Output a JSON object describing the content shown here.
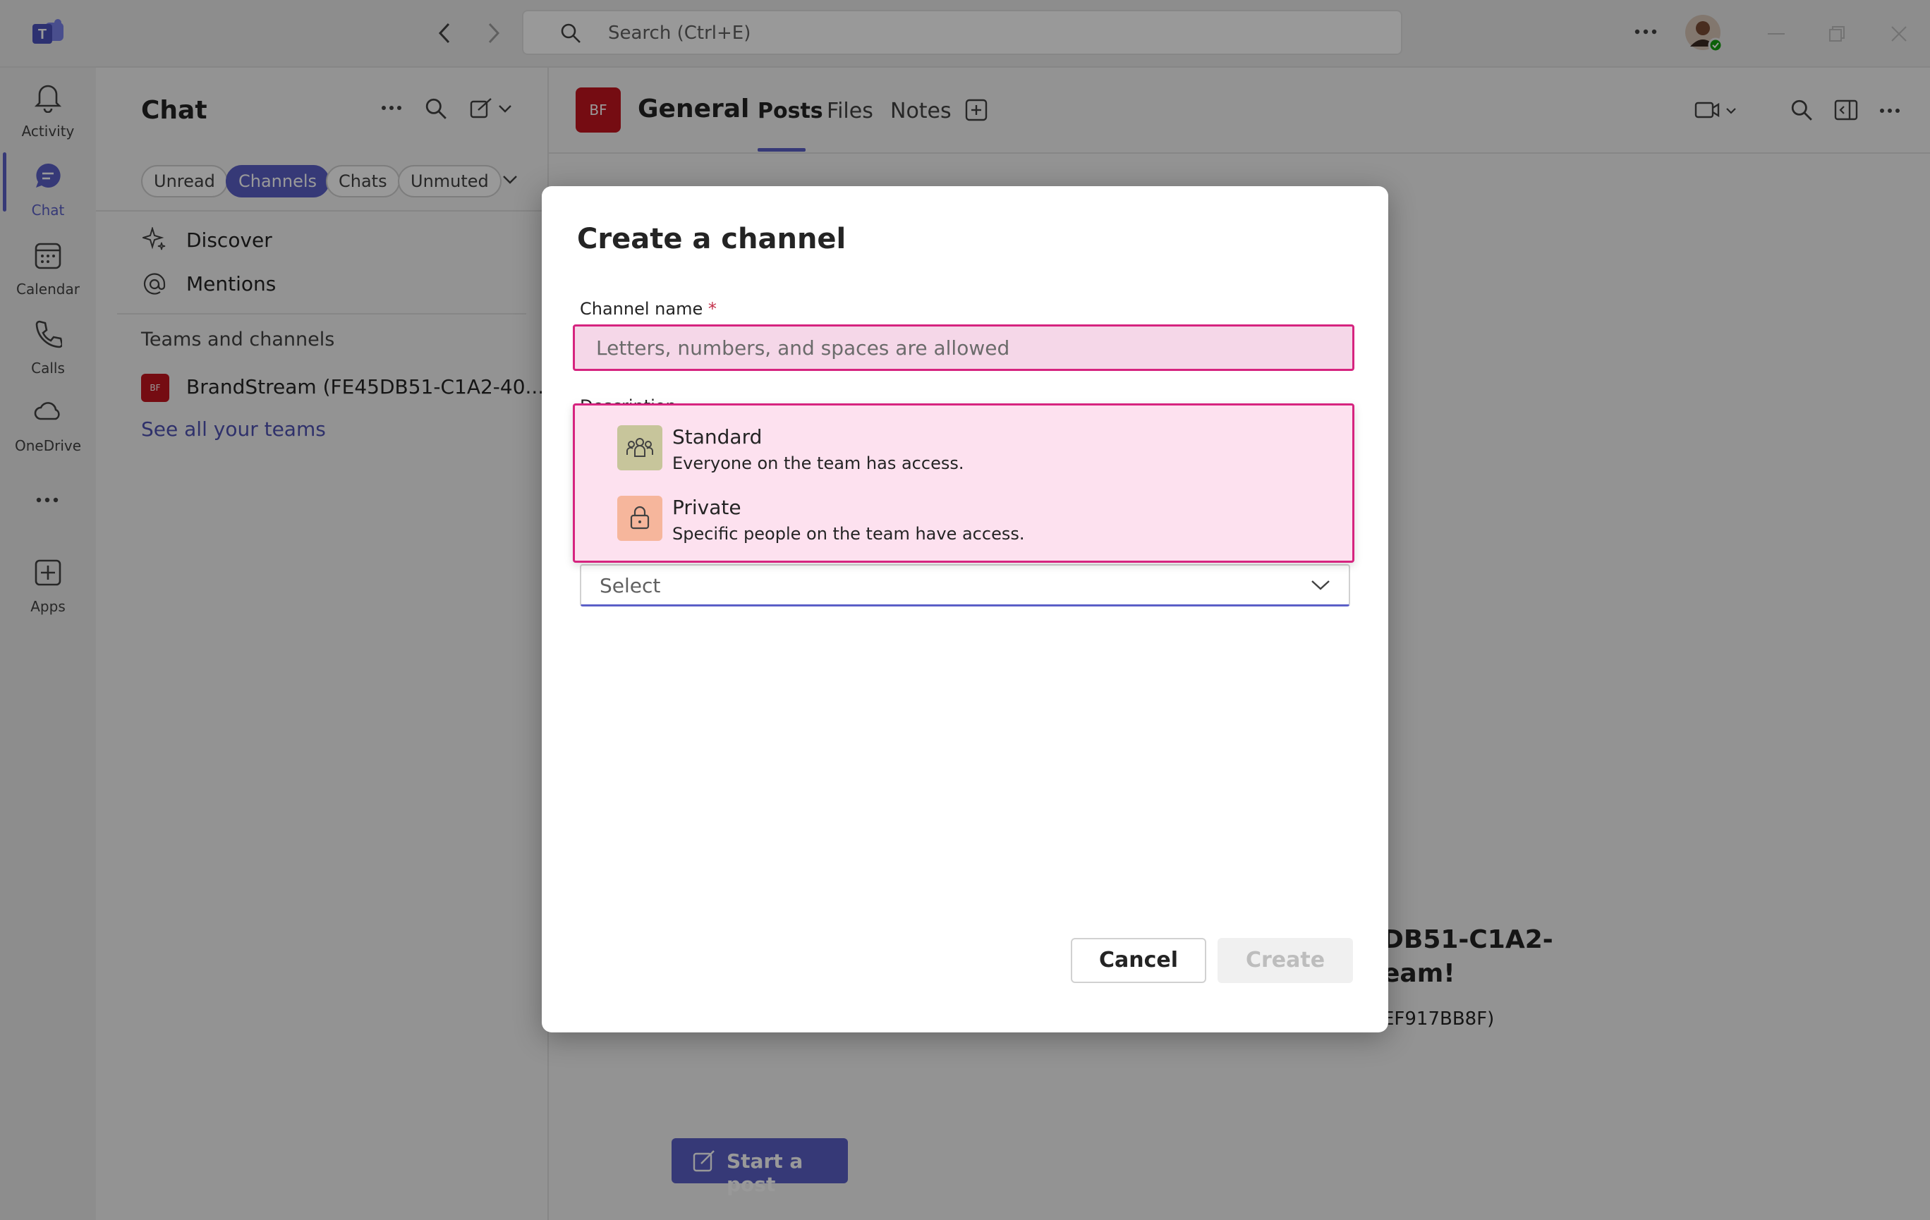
{
  "topbar": {
    "search_placeholder": "Search (Ctrl+E)"
  },
  "rail": {
    "items": [
      {
        "label": "Activity",
        "icon": "bell-icon"
      },
      {
        "label": "Chat",
        "icon": "chat-icon"
      },
      {
        "label": "Calendar",
        "icon": "calendar-icon"
      },
      {
        "label": "Calls",
        "icon": "phone-icon"
      },
      {
        "label": "OneDrive",
        "icon": "cloud-icon"
      },
      {
        "label": "Apps",
        "icon": "add-apps-icon"
      }
    ]
  },
  "panel": {
    "title": "Chat",
    "filters": [
      "Unread",
      "Channels",
      "Chats",
      "Unmuted"
    ],
    "active_filter": "Channels",
    "discover": "Discover",
    "mentions": "Mentions",
    "section_heading": "Teams and channels",
    "team_name": "BrandStream (FE45DB51-C1A2-40...",
    "team_avatar": "BF",
    "see_all": "See all your teams"
  },
  "channel": {
    "avatar": "BF",
    "name": "General",
    "tabs": [
      "Posts",
      "Files",
      "Notes"
    ],
    "active_tab": "Posts"
  },
  "background": {
    "welcome_line1": "DB51-C1A2-",
    "welcome_line2": "eam!",
    "id_fragment": "EF917BB8F)",
    "start_post": "Start a post"
  },
  "dialog": {
    "title": "Create a channel",
    "channel_name_label": "Channel name",
    "required_marker": "*",
    "channel_name_placeholder": "Letters, numbers, and spaces are allowed",
    "description_label": "Description",
    "options": [
      {
        "title": "Standard",
        "desc": "Everyone on the team has access.",
        "icon": "people-icon"
      },
      {
        "title": "Private",
        "desc": "Specific people on the team have access.",
        "icon": "lock-icon"
      }
    ],
    "select_value": "Select",
    "cancel": "Cancel",
    "create": "Create"
  },
  "colors": {
    "accent": "#5b5fc7",
    "highlight_border": "#d6247f",
    "team_avatar_bg": "#c4141e"
  }
}
